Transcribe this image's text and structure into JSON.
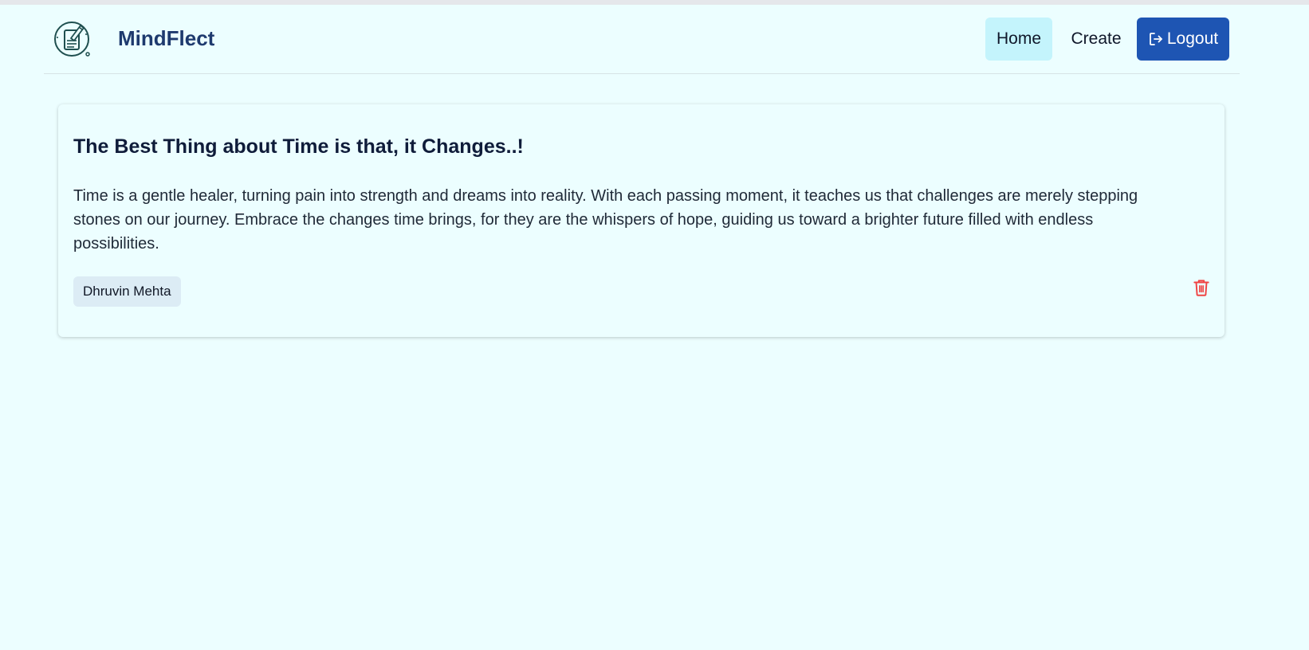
{
  "header": {
    "brand": "MindFlect",
    "logo_icon": "journal-pen-icon",
    "nav": {
      "home_label": "Home",
      "create_label": "Create",
      "logout_label": "Logout",
      "logout_icon": "logout-icon",
      "active": "Home"
    }
  },
  "posts": [
    {
      "title": "The Best Thing about Time is that, it Changes..!",
      "body": "Time is a gentle healer, turning pain into strength and dreams into reality. With each passing moment, it teaches us that challenges are merely stepping stones on our journey. Embrace the changes time brings, for they are the whispers of hope, guiding us toward a brighter future filled with endless possibilities.",
      "author": "Dhruvin Mehta",
      "delete_icon": "trash-icon"
    }
  ],
  "colors": {
    "background": "#ecfeff",
    "brand_text": "#1e3a6e",
    "home_active_bg": "#c4f4fc",
    "logout_bg": "#1e55b3",
    "delete_red": "#ef4444",
    "author_chip_bg": "#dcecf5"
  }
}
